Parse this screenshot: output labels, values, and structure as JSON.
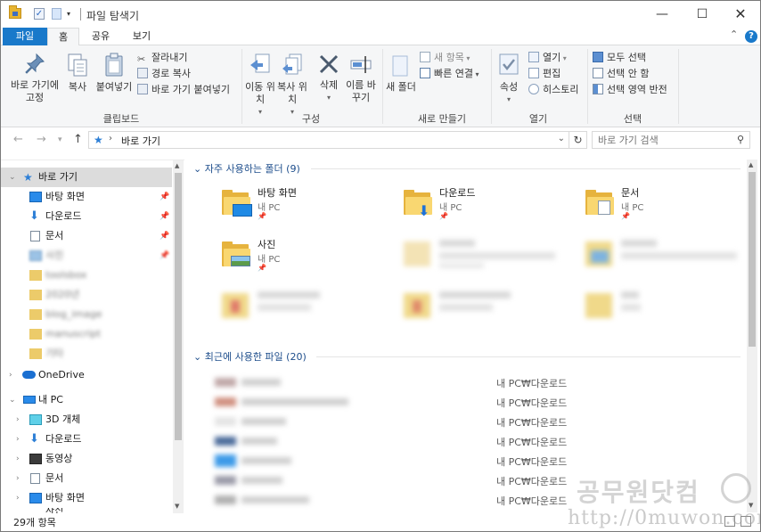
{
  "window": {
    "title": "파일 탐색기",
    "controls": {
      "minimize": "—",
      "maximize": "☐",
      "close": "✕"
    }
  },
  "tabs": [
    {
      "label": "파일"
    },
    {
      "label": "홈"
    },
    {
      "label": "공유"
    },
    {
      "label": "보기"
    }
  ],
  "ribbon": {
    "clipboard": {
      "label": "클립보드",
      "pin": "바로 가기에 고정",
      "copy": "복사",
      "paste": "붙여넣기",
      "cut": "잘라내기",
      "copy_path": "경로 복사",
      "paste_shortcut": "바로 가기 붙여넣기"
    },
    "organize": {
      "label": "구성",
      "move_to": "이동 위치",
      "copy_to": "복사 위치",
      "delete": "삭제",
      "rename": "이름 바꾸기"
    },
    "new": {
      "label": "새로 만들기",
      "new_folder": "새 폴더",
      "new_item": "새 항목",
      "easy_access": "빠른 연결"
    },
    "open": {
      "label": "열기",
      "properties": "속성",
      "open": "열기",
      "edit": "편집",
      "history": "히스토리"
    },
    "select": {
      "label": "선택",
      "select_all": "모두 선택",
      "select_none": "선택 안 함",
      "invert": "선택 영역 반전"
    }
  },
  "address": {
    "path": "바로 가기",
    "search_placeholder": "바로 가기 검색"
  },
  "nav": {
    "quick_access": "바로 가기",
    "pinned": [
      {
        "label": "바탕 화면"
      },
      {
        "label": "다운로드"
      },
      {
        "label": "문서"
      },
      {
        "label": "사진"
      }
    ],
    "recent_folders": [
      {
        "label": "toolsbox"
      },
      {
        "label": "2020년"
      },
      {
        "label": "blog_image"
      },
      {
        "label": "manuscript"
      },
      {
        "label": "기타"
      }
    ],
    "onedrive": "OneDrive",
    "this_pc": "내 PC",
    "pc_items": [
      {
        "label": "3D 개체"
      },
      {
        "label": "다운로드"
      },
      {
        "label": "동영상"
      },
      {
        "label": "문서"
      },
      {
        "label": "바탕 화면"
      },
      {
        "label": "사진"
      }
    ]
  },
  "content": {
    "frequent_header": "자주 사용하는 폴더 (9)",
    "frequent": [
      {
        "name": "바탕 화면",
        "location": "내 PC"
      },
      {
        "name": "다운로드",
        "location": "내 PC"
      },
      {
        "name": "문서",
        "location": "내 PC"
      },
      {
        "name": "사진",
        "location": "내 PC"
      }
    ],
    "recent_header": "최근에 사용한 파일 (20)",
    "recent_files": [
      {
        "name": "image_01",
        "location": "내 PC₩다운로드"
      },
      {
        "name": "document_2020_final",
        "location": "내 PC₩다운로드"
      },
      {
        "name": "capture",
        "location": "내 PC₩다운로드"
      },
      {
        "name": "screenshot",
        "location": "내 PC₩다운로드"
      },
      {
        "name": "photo_edit",
        "location": "내 PC₩다운로드"
      },
      {
        "name": "report_draft",
        "location": "내 PC₩다운로드"
      },
      {
        "name": "memo_file",
        "location": "내 PC₩다운로드"
      }
    ]
  },
  "status": {
    "count": "29개 항목"
  },
  "watermark": {
    "line1": "공무원닷컴",
    "line2": "http://0muwon.com"
  }
}
